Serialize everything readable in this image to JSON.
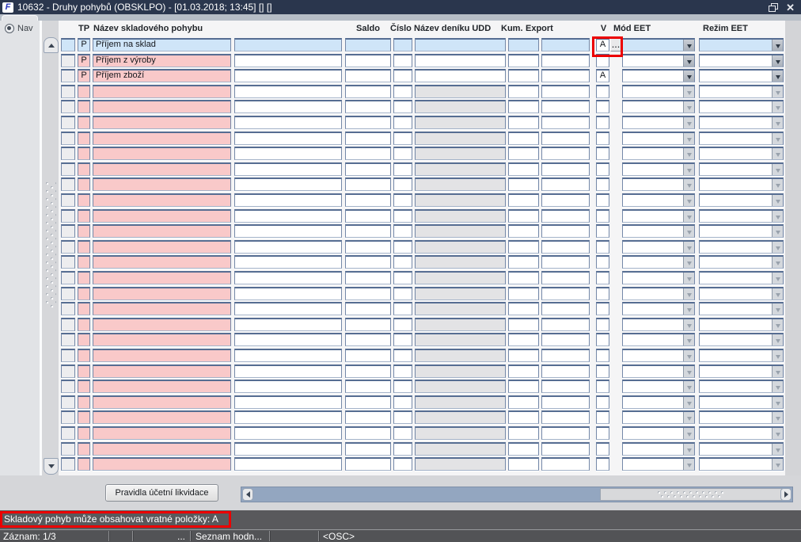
{
  "window": {
    "title": "10632 - Druhy pohybů (OBSKLPO) - [01.03.2018; 13:45] [] []",
    "close_glyph": "✕"
  },
  "sidebar": {
    "nav_label": "Nav"
  },
  "table": {
    "headers": {
      "tp": "TP",
      "name": "Název skladového pohybu",
      "saldo": "Saldo",
      "cislo": "Číslo",
      "denik": "Název deníku UDD",
      "kum": "Kum.",
      "export": "Export",
      "v": "V",
      "mod_eet": "Mód EET",
      "rezim_eet": "Režim EET"
    },
    "dots_button_label": "...",
    "rows": [
      {
        "tp": "P",
        "name": "Příjem na sklad",
        "v": "A",
        "selected": true,
        "has_dots_button": true
      },
      {
        "tp": "P",
        "name": "Příjem z výroby",
        "v": ""
      },
      {
        "tp": "P",
        "name": "Příjem zboží",
        "v": "A"
      }
    ],
    "empty_row_count": 25
  },
  "footer": {
    "rules_button_label": "Pravidla účetní likvidace"
  },
  "status": {
    "message": "Skladový pohyb může obsahovat vratné položky: A",
    "segments": [
      "Záznam: 1/3",
      "",
      "...",
      "Seznam hodn...",
      "",
      "<OSC>"
    ]
  },
  "colors": {
    "titlebar": "#2a364d",
    "selected_row": "#cfe5f8",
    "pink_row": "#f9c9c9",
    "disabled_field": "#e3e3e5",
    "highlight_red": "#ec0000",
    "statusbar": "#59595c"
  }
}
